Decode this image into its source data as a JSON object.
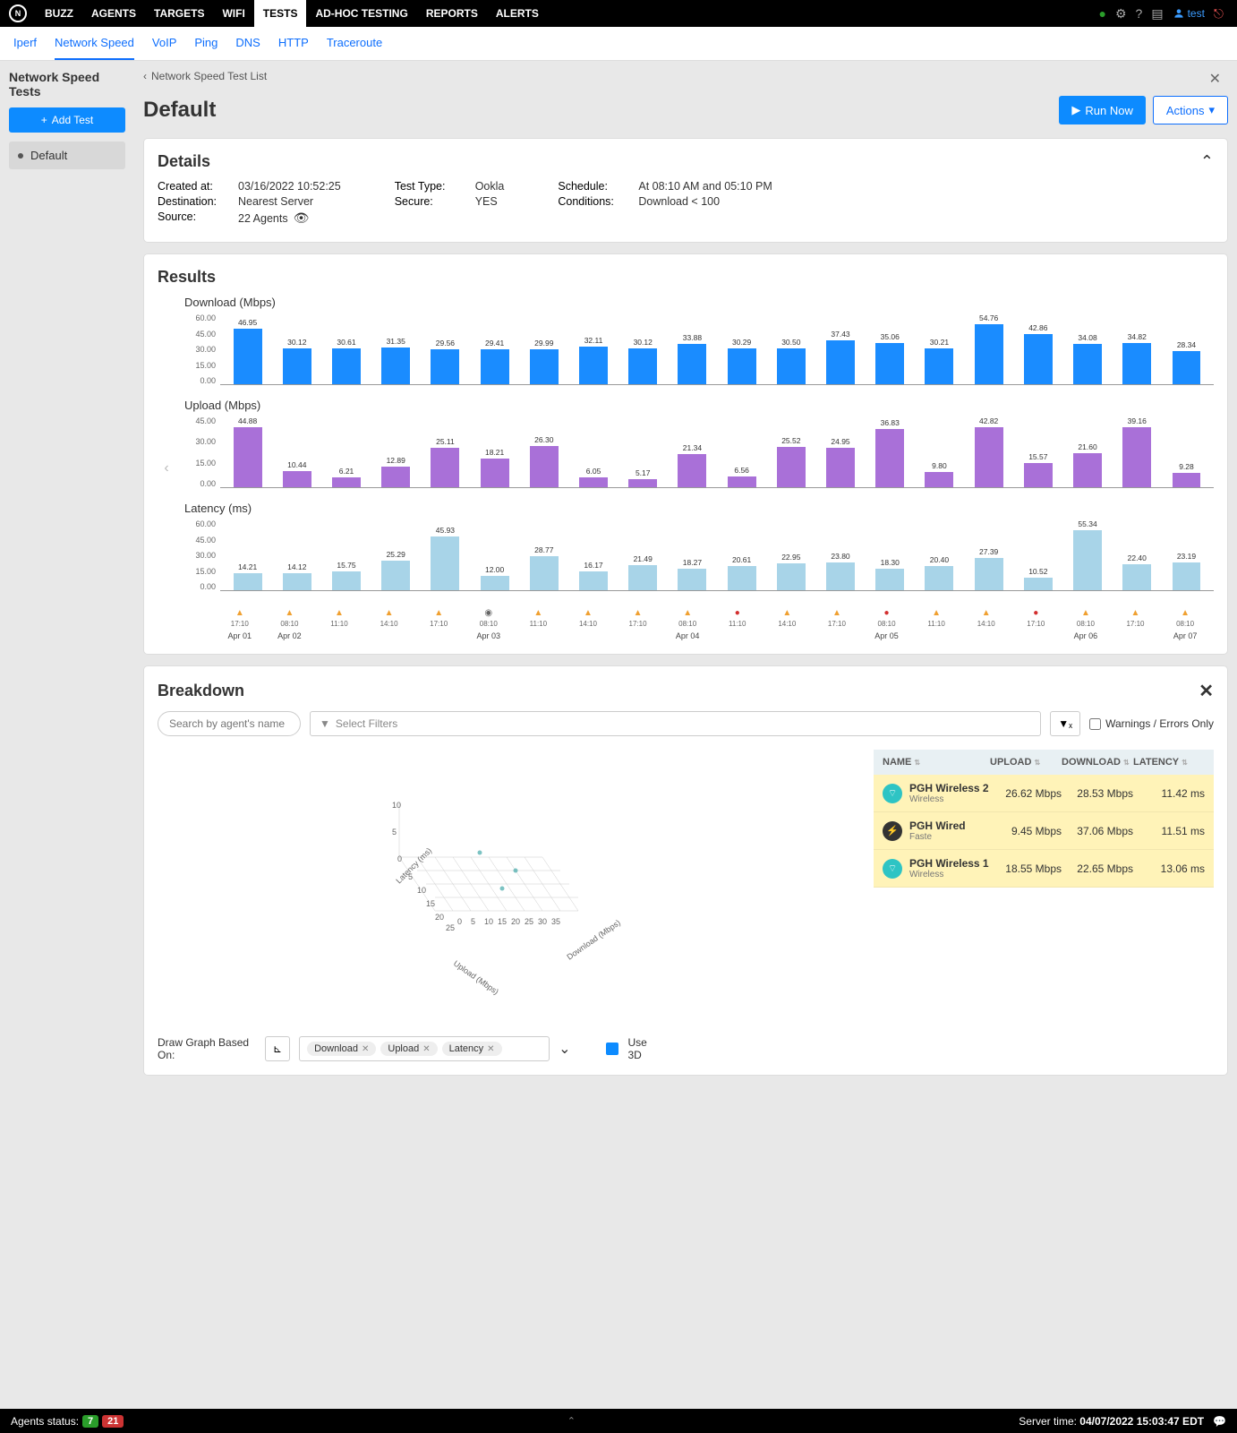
{
  "topnav": {
    "items": [
      "BUZZ",
      "AGENTS",
      "TARGETS",
      "WIFI",
      "TESTS",
      "AD-HOC TESTING",
      "REPORTS",
      "ALERTS"
    ],
    "active": 4,
    "user": "test"
  },
  "subnav": {
    "items": [
      "Iperf",
      "Network Speed",
      "VoIP",
      "Ping",
      "DNS",
      "HTTP",
      "Traceroute"
    ],
    "active": 1
  },
  "sidebar": {
    "title": "Network Speed Tests",
    "add_label": "Add Test",
    "tests": [
      "Default"
    ]
  },
  "page": {
    "back_label": "Network Speed Test List",
    "title": "Default",
    "run_now": "Run Now",
    "actions": "Actions"
  },
  "details": {
    "title": "Details",
    "rows": [
      {
        "label": "Created at:",
        "value": "03/16/2022 10:52:25"
      },
      {
        "label": "Destination:",
        "value": "Nearest Server"
      },
      {
        "label": "Source:",
        "value": "22 Agents",
        "eye": true
      }
    ],
    "rows2": [
      {
        "label": "Test Type:",
        "value": "Ookla"
      },
      {
        "label": "Secure:",
        "value": "YES"
      }
    ],
    "rows3": [
      {
        "label": "Schedule:",
        "value": "At 08:10 AM and 05:10 PM"
      },
      {
        "label": "Conditions:",
        "value": "Download < 100"
      }
    ]
  },
  "results": {
    "title": "Results",
    "charts": [
      {
        "title": "Download (Mbps)",
        "color": "download"
      },
      {
        "title": "Upload (Mbps)",
        "color": "upload"
      },
      {
        "title": "Latency (ms)",
        "color": "latency"
      }
    ],
    "x_times": [
      "17:10",
      "08:10",
      "11:10",
      "14:10",
      "17:10",
      "08:10",
      "11:10",
      "14:10",
      "17:10",
      "08:10",
      "11:10",
      "14:10",
      "17:10",
      "08:10",
      "11:10",
      "14:10",
      "17:10",
      "08:10",
      "17:10",
      "08:10"
    ],
    "x_status": [
      "warn",
      "warn",
      "warn",
      "warn",
      "warn",
      "info",
      "warn",
      "warn",
      "warn",
      "warn",
      "err",
      "warn",
      "warn",
      "err",
      "warn",
      "warn",
      "err",
      "warn",
      "warn",
      "warn"
    ],
    "dates": [
      "Apr 01",
      "Apr 02",
      "",
      "",
      "",
      "Apr 03",
      "",
      "",
      "",
      "Apr 04",
      "",
      "",
      "",
      "Apr 05",
      "",
      "",
      "",
      "Apr 06",
      "",
      "Apr 07"
    ]
  },
  "chart_data": [
    {
      "type": "bar",
      "title": "Download (Mbps)",
      "ylabel": "Mbps",
      "ylim": [
        0,
        60
      ],
      "categories": [
        "17:10",
        "08:10",
        "11:10",
        "14:10",
        "17:10",
        "08:10",
        "11:10",
        "14:10",
        "17:10",
        "08:10",
        "11:10",
        "14:10",
        "17:10",
        "08:10",
        "11:10",
        "14:10",
        "17:10",
        "08:10",
        "17:10",
        "08:10"
      ],
      "values": [
        46.95,
        30.12,
        30.61,
        31.35,
        29.56,
        29.41,
        29.99,
        32.11,
        30.12,
        33.88,
        30.29,
        30.5,
        37.43,
        35.06,
        30.21,
        54.76,
        42.86,
        34.08,
        34.82,
        28.34
      ]
    },
    {
      "type": "bar",
      "title": "Upload (Mbps)",
      "ylabel": "Mbps",
      "ylim": [
        0,
        45
      ],
      "categories": [
        "17:10",
        "08:10",
        "11:10",
        "14:10",
        "17:10",
        "08:10",
        "11:10",
        "14:10",
        "17:10",
        "08:10",
        "11:10",
        "14:10",
        "17:10",
        "08:10",
        "11:10",
        "14:10",
        "17:10",
        "08:10",
        "17:10",
        "08:10"
      ],
      "values": [
        44.88,
        10.44,
        6.21,
        12.89,
        25.11,
        18.21,
        26.3,
        6.05,
        5.17,
        21.34,
        6.56,
        25.52,
        24.95,
        36.83,
        9.8,
        42.82,
        15.57,
        21.6,
        39.16,
        9.28
      ]
    },
    {
      "type": "bar",
      "title": "Latency (ms)",
      "ylabel": "ms",
      "ylim": [
        0,
        60
      ],
      "categories": [
        "17:10",
        "08:10",
        "11:10",
        "14:10",
        "17:10",
        "08:10",
        "11:10",
        "14:10",
        "17:10",
        "08:10",
        "11:10",
        "14:10",
        "17:10",
        "08:10",
        "11:10",
        "14:10",
        "17:10",
        "08:10",
        "17:10",
        "08:10"
      ],
      "values": [
        14.21,
        14.12,
        15.75,
        25.29,
        45.93,
        12.0,
        28.77,
        16.17,
        21.49,
        18.27,
        20.61,
        22.95,
        23.8,
        18.3,
        20.4,
        27.39,
        10.52,
        55.34,
        22.4,
        23.19
      ]
    },
    {
      "type": "scatter",
      "title": "Breakdown 3D",
      "axes": [
        "Latency (ms)",
        "Upload (Mbps)",
        "Download (Mbps)"
      ],
      "series": [
        {
          "name": "PGH Wireless 2",
          "point": {
            "latency": 11.42,
            "upload": 26.62,
            "download": 28.53
          }
        },
        {
          "name": "PGH Wired",
          "point": {
            "latency": 11.51,
            "upload": 9.45,
            "download": 37.06
          }
        },
        {
          "name": "PGH Wireless 1",
          "point": {
            "latency": 13.06,
            "upload": 18.55,
            "download": 22.65
          }
        }
      ]
    }
  ],
  "breakdown": {
    "title": "Breakdown",
    "search_placeholder": "Search by agent's name",
    "filter_placeholder": "Select Filters",
    "warn_label": "Warnings / Errors Only",
    "columns": [
      "NAME",
      "UPLOAD",
      "DOWNLOAD",
      "LATENCY"
    ],
    "rows": [
      {
        "name": "PGH Wireless 2",
        "sub": "Wireless",
        "type": "wifi",
        "upload": "26.62 Mbps",
        "download": "28.53 Mbps",
        "latency": "11.42 ms"
      },
      {
        "name": "PGH Wired",
        "sub": "Faste",
        "type": "wired",
        "upload": "9.45 Mbps",
        "download": "37.06 Mbps",
        "latency": "11.51 ms"
      },
      {
        "name": "PGH Wireless 1",
        "sub": "Wireless",
        "type": "wifi",
        "upload": "18.55 Mbps",
        "download": "22.65 Mbps",
        "latency": "13.06 ms"
      }
    ],
    "graph_label": "Draw Graph Based On:",
    "chips": [
      "Download",
      "Upload",
      "Latency"
    ],
    "use3d": "Use 3D",
    "plot_axes": {
      "z": "Latency (ms)",
      "y": "Upload (Mbps)",
      "x": "Download (Mbps)"
    }
  },
  "statusbar": {
    "agents_label": "Agents status:",
    "green": "7",
    "red": "21",
    "server_label": "Server time:",
    "server_time": "04/07/2022 15:03:47 EDT"
  },
  "y_ticks": {
    "sixty": [
      "60.00",
      "45.00",
      "30.00",
      "15.00",
      "0.00"
    ],
    "fortyfive": [
      "45.00",
      "30.00",
      "15.00",
      "0.00"
    ]
  }
}
